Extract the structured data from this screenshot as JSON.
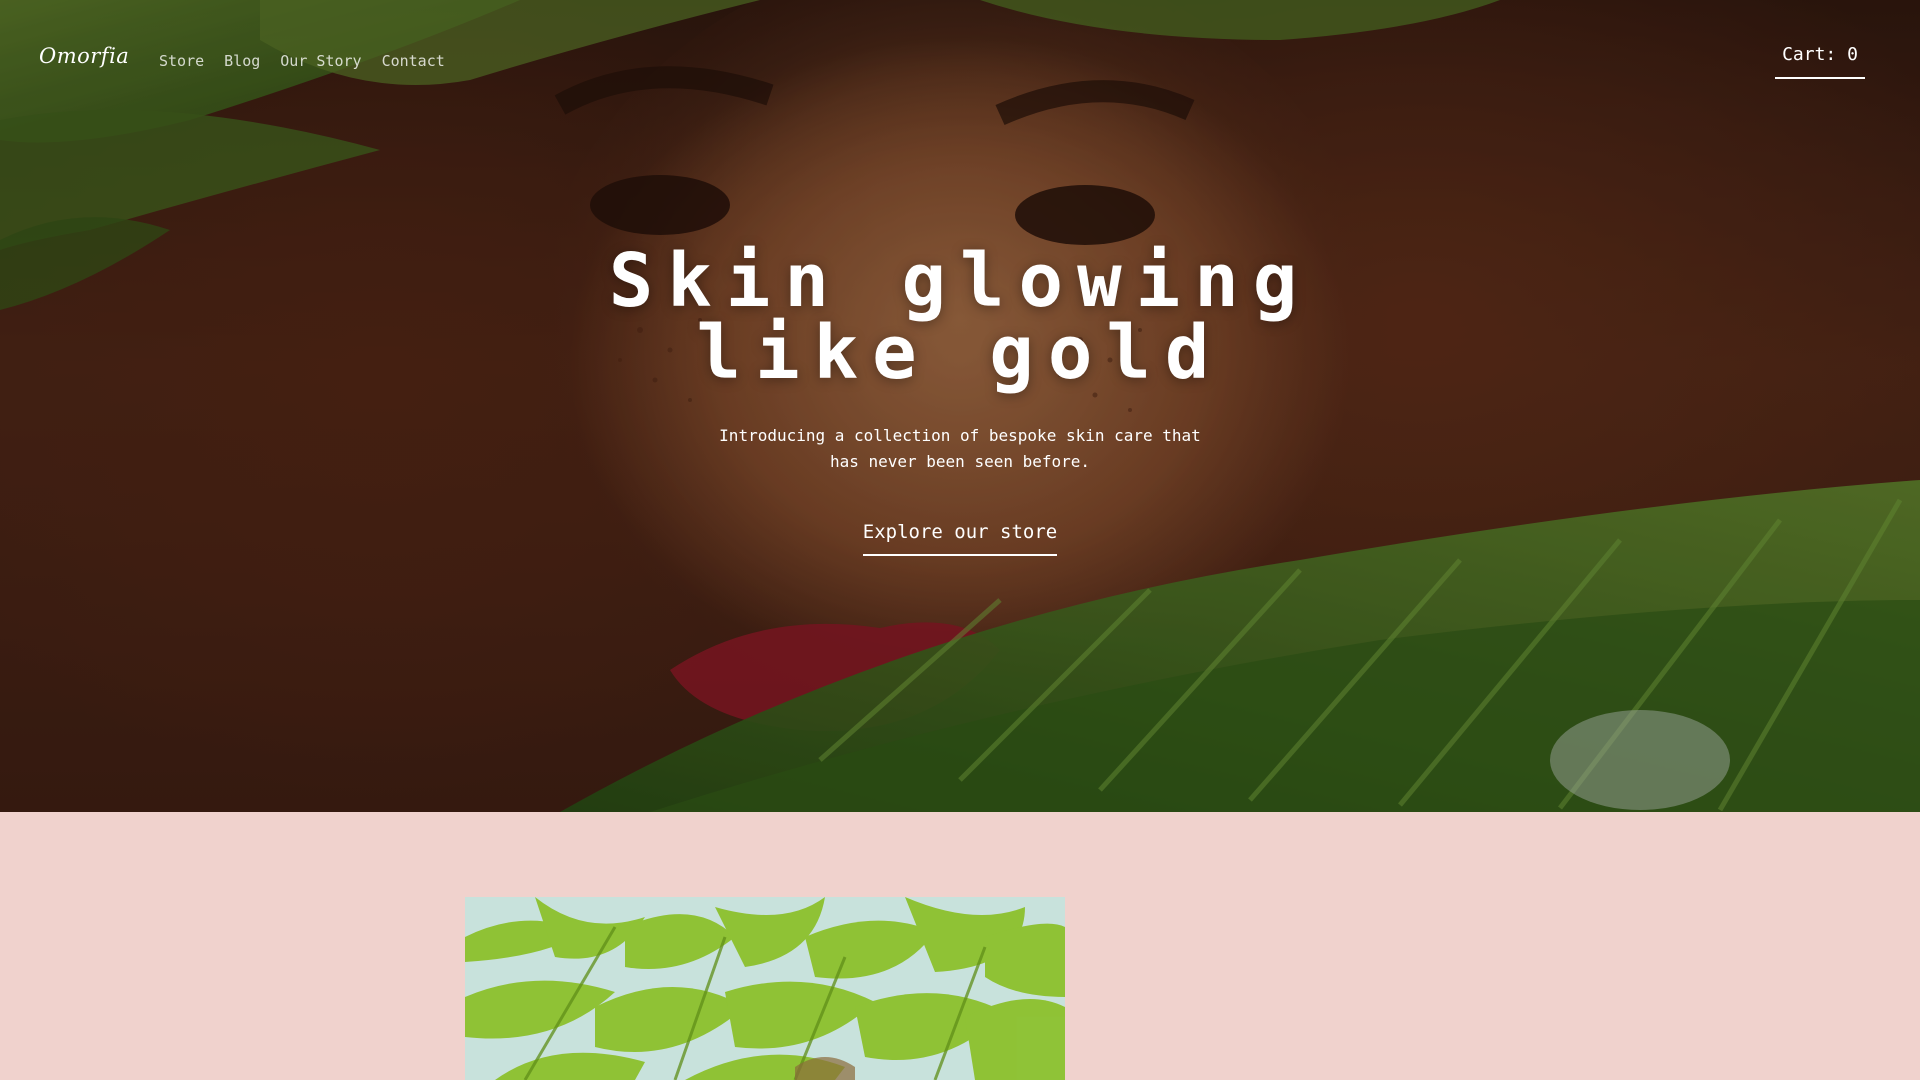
{
  "nav": {
    "brand": "Omorfia",
    "links": [
      {
        "label": "Store"
      },
      {
        "label": "Blog"
      },
      {
        "label": "Our Story"
      },
      {
        "label": "Contact"
      }
    ],
    "cart_label": "Cart: 0"
  },
  "hero": {
    "title_line_1": "Skin glowing",
    "title_line_2": "like gold",
    "subtitle": "Introducing a collection of bespoke skin care that has never been seen before.",
    "cta_label": "Explore our store"
  },
  "colors": {
    "background_pink": "#f0d2cd",
    "text_white": "#ffffff",
    "hero_dark_brown": "#3a1d12",
    "leaf_green": "#4f7d26",
    "bamboo_green": "#94c72f"
  },
  "images": {
    "hero_photo": "portrait-with-palm-leaves",
    "feature_photo": "bamboo-plant"
  }
}
